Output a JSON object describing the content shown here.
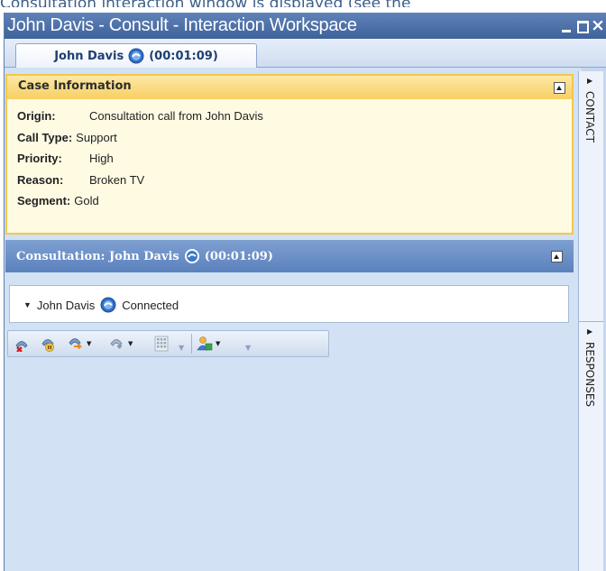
{
  "caption": "Consultation interaction window is displayed (see the",
  "window": {
    "title": "John Davis - Consult - Interaction Workspace"
  },
  "tab": {
    "name": "John Davis",
    "timer": "(00:01:09)"
  },
  "side_tabs": [
    "CONTACT",
    "RESPONSES"
  ],
  "case_info": {
    "title": "Case Information",
    "fields": [
      {
        "label": "Origin:",
        "value": "Consultation call from John Davis"
      },
      {
        "label": "Call Type:",
        "value": "Support"
      },
      {
        "label": "Priority:",
        "value": "High"
      },
      {
        "label": "Reason:",
        "value": "Broken TV"
      },
      {
        "label": "Segment:",
        "value": "Gold"
      }
    ]
  },
  "consultation": {
    "title_prefix": "Consultation: John Davis",
    "timer": "(00:01:09)",
    "party": {
      "name": "John Davis",
      "status": "Connected"
    }
  },
  "toolbar": {
    "icons": [
      "end-call-icon",
      "hold-call-icon",
      "transfer-call-icon",
      "conference-call-icon",
      "keypad-icon",
      "party-action-icon"
    ]
  },
  "colors": {
    "title_bar": "#4a6ea6",
    "case_header": "#f7cf63",
    "consult_header": "#6b8fc7",
    "content_bg": "#d3e1f4"
  }
}
